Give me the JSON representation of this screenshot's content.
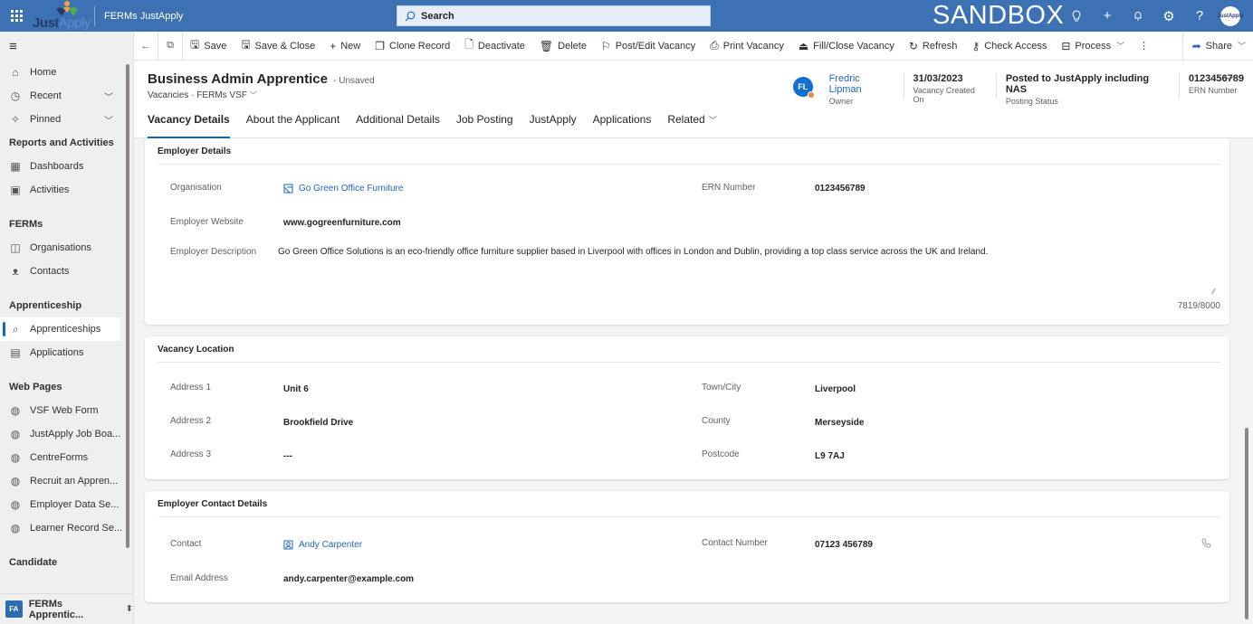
{
  "topbar": {
    "logo": {
      "part1": "Just",
      "part2": "Apply"
    },
    "app_title": "FERMs JustApply",
    "search_label": "Search",
    "environment": "SANDBOX",
    "icons": [
      "lightbulb-icon",
      "plus-icon",
      "bell-icon",
      "gear-icon",
      "help-icon"
    ],
    "avatar_text": "JustApply"
  },
  "sidebar": {
    "top_items": [
      {
        "label": "Home",
        "icon": "home-icon"
      },
      {
        "label": "Recent",
        "icon": "clock-icon",
        "expandable": true
      },
      {
        "label": "Pinned",
        "icon": "pin-icon",
        "expandable": true
      }
    ],
    "sections": [
      {
        "title": "Reports and Activities",
        "items": [
          {
            "label": "Dashboards",
            "icon": "dashboard-icon"
          },
          {
            "label": "Activities",
            "icon": "clipboard-icon"
          }
        ]
      },
      {
        "title": "FERMs",
        "items": [
          {
            "label": "Organisations",
            "icon": "organisation-icon"
          },
          {
            "label": "Contacts",
            "icon": "person-icon"
          }
        ]
      },
      {
        "title": "Apprenticeship",
        "items": [
          {
            "label": "Apprenticeships",
            "icon": "apprenticeship-icon",
            "active": true
          },
          {
            "label": "Applications",
            "icon": "application-icon"
          }
        ]
      },
      {
        "title": "Web Pages",
        "items": [
          {
            "label": "VSF Web Form",
            "icon": "web-page-icon"
          },
          {
            "label": "JustApply Job Boa...",
            "icon": "web-page-icon"
          },
          {
            "label": "CentreForms",
            "icon": "web-page-icon"
          },
          {
            "label": "Recruit an Appren...",
            "icon": "web-page-icon"
          },
          {
            "label": "Employer Data Se...",
            "icon": "web-page-icon"
          },
          {
            "label": "Learner Record Se...",
            "icon": "web-page-icon"
          }
        ]
      },
      {
        "title": "Candidate",
        "items": []
      }
    ],
    "area": {
      "badge": "FA",
      "name": "FERMs Apprentic..."
    }
  },
  "commandbar": {
    "items": [
      {
        "label": "Save",
        "icon": "save-icon"
      },
      {
        "label": "Save & Close",
        "icon": "save-close-icon"
      },
      {
        "label": "New",
        "icon": "plus-icon"
      },
      {
        "label": "Clone Record",
        "icon": "clone-icon"
      },
      {
        "label": "Deactivate",
        "icon": "deactivate-icon"
      },
      {
        "label": "Delete",
        "icon": "delete-icon"
      },
      {
        "label": "Post/Edit Vacancy",
        "icon": "signpost-icon"
      },
      {
        "label": "Print Vacancy",
        "icon": "print-icon"
      },
      {
        "label": "Fill/Close Vacancy",
        "icon": "fill-close-icon"
      },
      {
        "label": "Refresh",
        "icon": "refresh-icon"
      },
      {
        "label": "Check Access",
        "icon": "key-icon"
      },
      {
        "label": "Process",
        "icon": "process-icon",
        "dropdown": true
      }
    ],
    "share_label": "Share"
  },
  "header": {
    "title": "Business Admin Apprentice",
    "save_state": "- Unsaved",
    "entity": "Vacancies",
    "form": "FERMs VSF",
    "owner": {
      "initials": "FL",
      "name": "Fredric Lipman",
      "label": "Owner"
    },
    "fields": [
      {
        "value": "31/03/2023",
        "label": "Vacancy Created On"
      },
      {
        "value": "Posted to JustApply including NAS",
        "label": "Posting Status"
      },
      {
        "value": "0123456789",
        "label": "ERN Number"
      }
    ],
    "tabs": [
      {
        "label": "Vacancy Details",
        "active": true
      },
      {
        "label": "About the Applicant"
      },
      {
        "label": "Additional Details"
      },
      {
        "label": "Job Posting"
      },
      {
        "label": "JustApply"
      },
      {
        "label": "Applications"
      },
      {
        "label": "Related",
        "dropdown": true
      }
    ]
  },
  "employer_details": {
    "title": "Employer Details",
    "organisation": {
      "label": "Organisation",
      "value": "Go Green Office Furniture"
    },
    "ern": {
      "label": "ERN Number",
      "value": "0123456789"
    },
    "website": {
      "label": "Employer Website",
      "value": "www.gogreenfurniture.com"
    },
    "description": {
      "label": "Employer Description",
      "value": "Go Green Office Solutions is an eco-friendly office furniture supplier based in Liverpool with offices in London and Dublin, providing a top class service across the UK and Ireland."
    },
    "char_count": "7819/8000"
  },
  "vacancy_location": {
    "title": "Vacancy Location",
    "address1": {
      "label": "Address 1",
      "value": "Unit 6"
    },
    "address2": {
      "label": "Address 2",
      "value": "Brookfield Drive"
    },
    "address3": {
      "label": "Address 3",
      "value": "---"
    },
    "town": {
      "label": "Town/City",
      "value": "Liverpool"
    },
    "county": {
      "label": "County",
      "value": "Merseyside"
    },
    "postcode": {
      "label": "Postcode",
      "value": "L9 7AJ"
    }
  },
  "employer_contact": {
    "title": "Employer Contact Details",
    "contact": {
      "label": "Contact",
      "value": "Andy Carpenter"
    },
    "email": {
      "label": "Email Address",
      "value": "andy.carpenter@example.com"
    },
    "number": {
      "label": "Contact Number",
      "value": "07123 456789"
    }
  },
  "colors": {
    "topbar": "#3c72b4",
    "accent": "#0f6cbd",
    "link": "#2266c2",
    "presence": "#f4833c"
  }
}
